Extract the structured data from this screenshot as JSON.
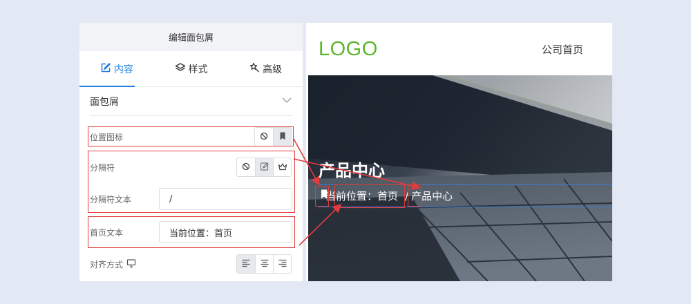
{
  "editor": {
    "title": "编辑面包屑",
    "tabs": [
      {
        "label": "内容",
        "icon": "edit-icon"
      },
      {
        "label": "样式",
        "icon": "layers-icon"
      },
      {
        "label": "高级",
        "icon": "magic-wand-icon"
      }
    ],
    "section": {
      "label": "面包屑",
      "icon": "chevron-down-icon"
    },
    "fields": {
      "position_icon": {
        "label": "位置图标",
        "options": [
          "ban-icon",
          "bookmark-icon"
        ],
        "selected": "bookmark-icon"
      },
      "separator": {
        "label": "分隔符",
        "options": [
          "ban-icon",
          "edit-icon",
          "crown-icon"
        ],
        "selected": "edit-icon"
      },
      "separator_text": {
        "label": "分隔符文本",
        "value": "/"
      },
      "home_text": {
        "label": "首页文本",
        "value": "当前位置：首页"
      },
      "alignment": {
        "label": "对齐方式",
        "label_icon": "monitor-icon",
        "options": [
          "align-left-icon",
          "align-center-icon",
          "align-right-icon"
        ],
        "selected": "align-left-icon"
      }
    }
  },
  "preview": {
    "logo": "LOGO",
    "nav_link": "公司首页",
    "banner_title": "产品中心",
    "breadcrumb": {
      "icon": "bookmark-icon",
      "home": "当前位置：首页",
      "separator": "/",
      "current": "产品中心"
    }
  },
  "colors": {
    "accent": "#1f7fe2",
    "logo": "#5bb62c",
    "annotation": "#e23b3b",
    "background": "#e3e9f4"
  }
}
